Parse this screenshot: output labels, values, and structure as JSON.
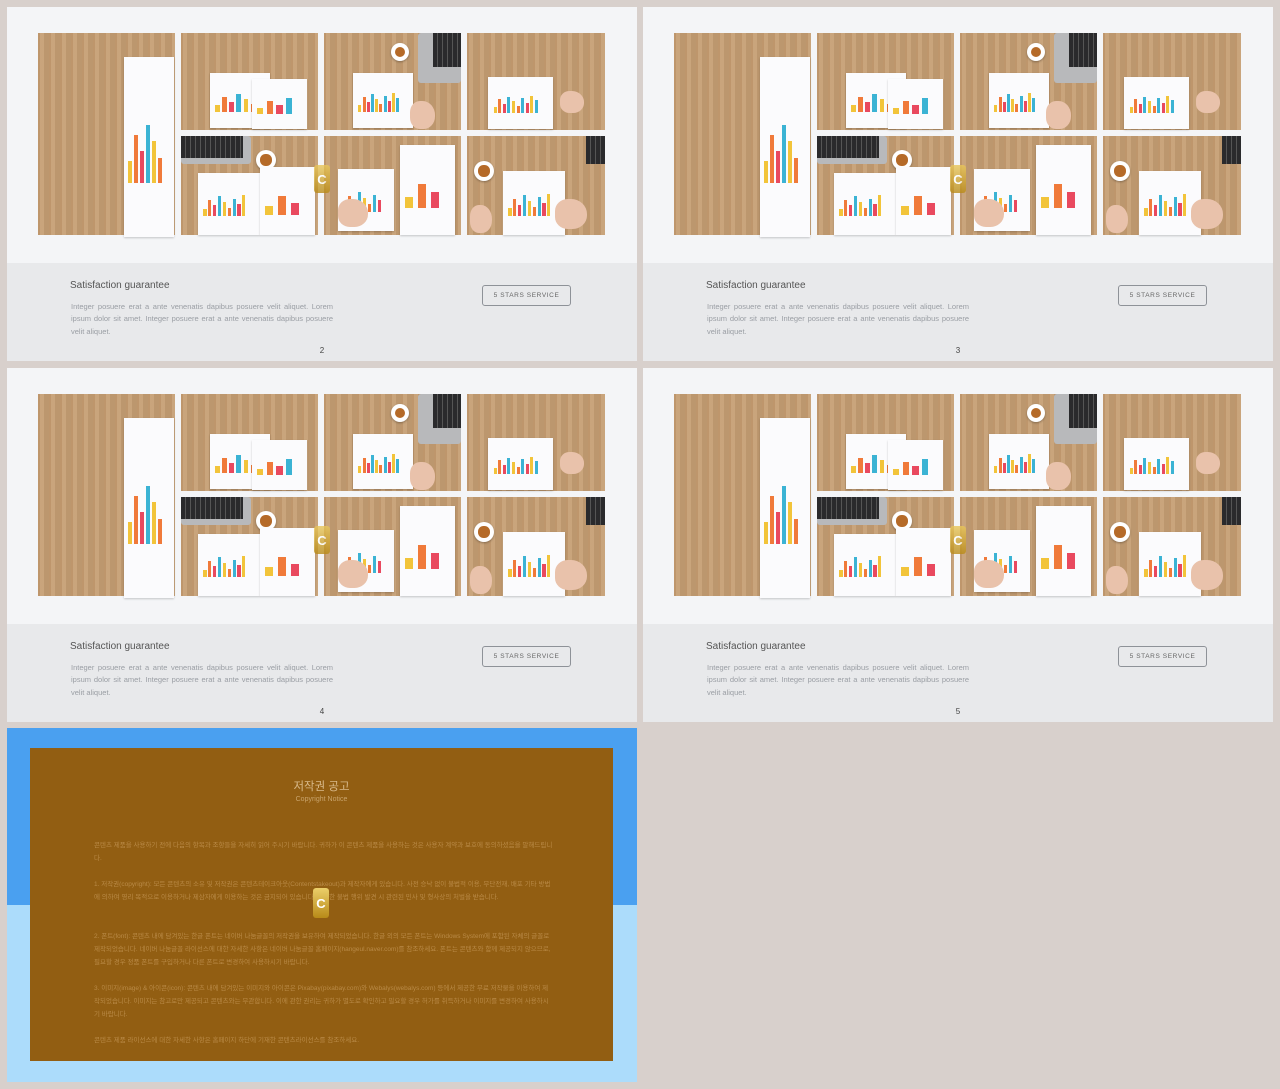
{
  "slides": [
    {
      "title": "Satisfaction guarantee",
      "text": "Integer posuere erat a ante venenatis dapibus posuere velit aliquet. Lorem ipsum dolor sit amet. Integer posuere erat a ante venenatis dapibus posuere velit aliquet.",
      "button": "5 STARS SERVICE",
      "page": "2"
    },
    {
      "title": "Satisfaction guarantee",
      "text": "Integer posuere erat a ante venenatis dapibus posuere velit aliquet. Lorem ipsum dolor sit amet. Integer posuere erat a ante venenatis dapibus posuere velit aliquet.",
      "button": "5 STARS SERVICE",
      "page": "3"
    },
    {
      "title": "Satisfaction guarantee",
      "text": "Integer posuere erat a ante venenatis dapibus posuere velit aliquet. Lorem ipsum dolor sit amet. Integer posuere erat a ante venenatis dapibus posuere velit aliquet.",
      "button": "5 STARS SERVICE",
      "page": "4"
    },
    {
      "title": "Satisfaction guarantee",
      "text": "Integer posuere erat a ante venenatis dapibus posuere velit aliquet. Lorem ipsum dolor sit amet. Integer posuere erat a ante venenatis dapibus posuere velit aliquet.",
      "button": "5 STARS SERVICE",
      "page": "5"
    }
  ],
  "watermark": {
    "letter": "C"
  },
  "notice": {
    "title": "저작권 공고",
    "subtitle": "Copyright Notice",
    "intro": "콘텐츠 제품을 사용하기 전에 다음의 항목과 조항들을 자세히 읽어 주시기 바랍니다. 귀하가 이 콘텐츠 제품을 사용하는 것은 사용자 계약과 보호에 동의하셨음을 말해드립니다.",
    "p1": "1. 저작권(copyright): 모든 콘텐츠의 소유 및 저작권은 콘텐츠테이크아웃(Contentstakeout)과 제작자에게 있습니다. 사전 승낙 없이 불법적 이용, 무단전재, 배포 기타 방법에 의하여 영리 목적으로 이용하거나 제삼자에게 이용하는 것은 금지되어 있습니다. 이러한 불법 행위 발견 시 관련된 민사 및 형사상의 처벌을 받습니다.",
    "p2": "2. 폰트(font): 콘텐츠 내에 담겨있는 한글 폰트는 네이버 나눔글꼴의 저작권을 보유하여 제작되었습니다. 한글 외의 모든 폰트는 Windows System에 포함된 자체의 글꼴로 제작되었습니다. 네이버 나눔글꼴 라이선스에 대한 자세한 사항은 네이버 나눔글꼴 홈페이지(hangeul.naver.com)를 참조하세요. 폰트는 콘텐츠와 함께 제공되지 않으므로, 필요할 경우 정품 폰트를 구입하거나 다른 폰트로 변경하여 사용하시기 바랍니다.",
    "p3": "3. 이미지(image) & 아이콘(icon): 콘텐츠 내에 담겨있는 이미지와 아이콘은 Pixabay(pixabay.com)와 Webalys(webalys.com) 등에서 제공한 무료 저작물을 이용하여 제작되었습니다. 이미지는 참고로만 제공되고 콘텐츠와는 무관합니다. 이에 관한 권리는 귀하가 별도로 확인하고 필요할 경우 허가를 취득하거나 이미지를 변경하여 사용하시기 바랍니다.",
    "closing": "콘텐츠 제품 라이선스에 대한 자세한 사항은 홈페이지 하단에 기재한 콘텐츠라이선스를 참조하세요."
  },
  "colors": {
    "background": "#d8d0cc",
    "slide": "#f4f5f7",
    "footer": "#e8e9eb",
    "notice_panel": "#925e12",
    "notice_top": "#4aa0f0",
    "notice_bottom": "#acdcfb"
  }
}
